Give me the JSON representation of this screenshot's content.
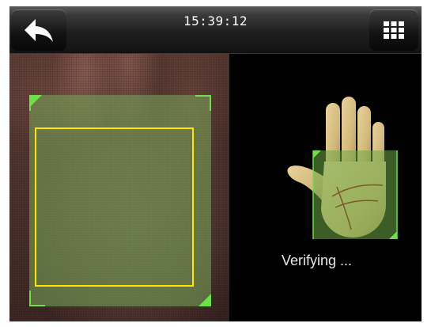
{
  "header": {
    "time": "15:39:12",
    "back_icon": "back-arrow-icon",
    "menu_icon": "grid-menu-icon"
  },
  "verification": {
    "status_text": "Verifying ..."
  },
  "colors": {
    "guide_green": "#6ee04a",
    "capture_box_yellow": "#ffe600",
    "background": "#000000"
  }
}
